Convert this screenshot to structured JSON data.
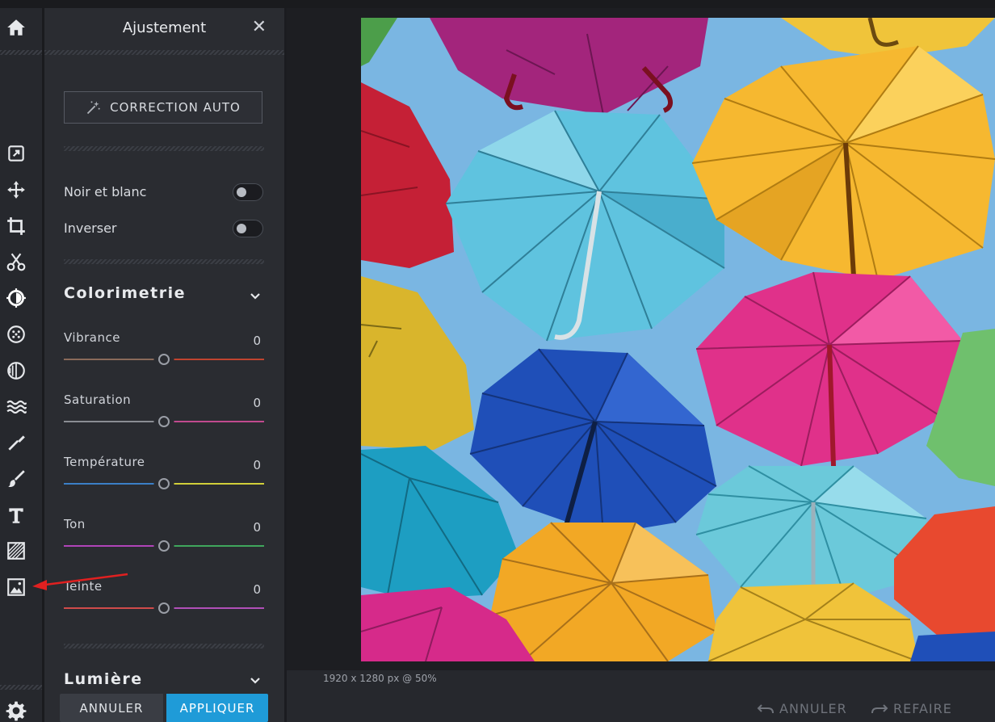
{
  "panel": {
    "title": "Ajustement",
    "close_icon": "close-icon",
    "auto_correction_label": "CORRECTION AUTO",
    "toggles": [
      {
        "label": "Noir et blanc",
        "on": false
      },
      {
        "label": "Inverser",
        "on": false
      }
    ],
    "sections": {
      "colorimetrie": "Colorimetrie",
      "lumiere": "Lumière"
    },
    "sliders": [
      {
        "label": "Vibrance",
        "value": "0",
        "position": 0.5,
        "colors": [
          "#8a6a5a",
          "#c0442f"
        ]
      },
      {
        "label": "Saturation",
        "value": "0",
        "position": 0.5,
        "colors": [
          "#8a8d93",
          "#c04a8f"
        ]
      },
      {
        "label": "Température",
        "value": "0",
        "position": 0.5,
        "colors": [
          "#3b7fc7",
          "#d1cf3a"
        ]
      },
      {
        "label": "Ton",
        "value": "0",
        "position": 0.5,
        "colors": [
          "#b044b8",
          "#3fa65c"
        ]
      },
      {
        "label": "Teinte",
        "value": "0",
        "position": 0.5,
        "colors": [
          "#d04b4b",
          "#b04fb8"
        ]
      }
    ],
    "cancel_label": "ANNULER",
    "apply_label": "APPLIQUER"
  },
  "status": {
    "image_info": "1920 x 1280 px @ 50%"
  },
  "history": {
    "undo_label": "ANNULER",
    "redo_label": "REFAIRE"
  },
  "colors": {
    "accent": "#1f9bd8",
    "panel_bg": "#2a2c31",
    "rail_bg": "#26282d",
    "arrow": "#e02020"
  },
  "rail_icons": [
    "home-icon",
    "export-icon",
    "move-icon",
    "crop-icon",
    "cut-icon",
    "adjust-icon",
    "effects-icon",
    "filter-icon",
    "wave-icon",
    "brush-icon",
    "paint-icon",
    "text-icon",
    "texture-icon",
    "image-icon",
    "settings-icon"
  ]
}
